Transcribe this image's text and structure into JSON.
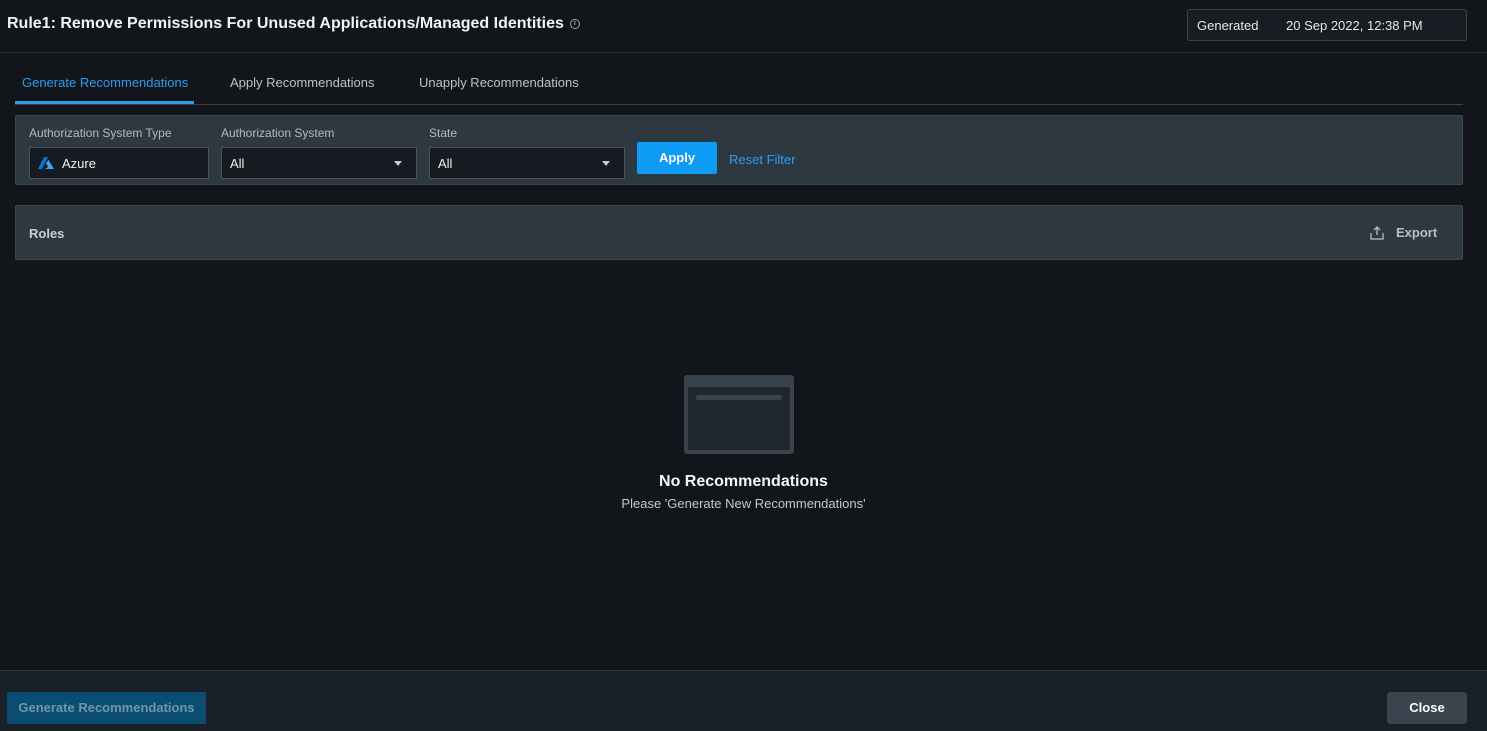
{
  "header": {
    "title": "Rule1: Remove Permissions For Unused Applications/Managed Identities",
    "generated_label": "Generated",
    "generated_value": "20 Sep 2022, 12:38 PM"
  },
  "tabs": [
    {
      "label": "Generate Recommendations",
      "active": true
    },
    {
      "label": "Apply Recommendations",
      "active": false
    },
    {
      "label": "Unapply Recommendations",
      "active": false
    }
  ],
  "filters": {
    "auth_system_type": {
      "label": "Authorization System Type",
      "value": "Azure"
    },
    "auth_system": {
      "label": "Authorization System",
      "value": "All"
    },
    "state": {
      "label": "State",
      "value": "All"
    },
    "apply_label": "Apply",
    "reset_label": "Reset Filter"
  },
  "roles": {
    "title": "Roles",
    "export_label": "Export"
  },
  "empty_state": {
    "title": "No Recommendations",
    "subtitle": "Please 'Generate New Recommendations'"
  },
  "footer": {
    "generate_label": "Generate Recommendations",
    "close_label": "Close"
  },
  "colors": {
    "accent": "#2d9cf0",
    "apply_button": "#0e9bf5",
    "azure_brand": "#0078d4"
  }
}
